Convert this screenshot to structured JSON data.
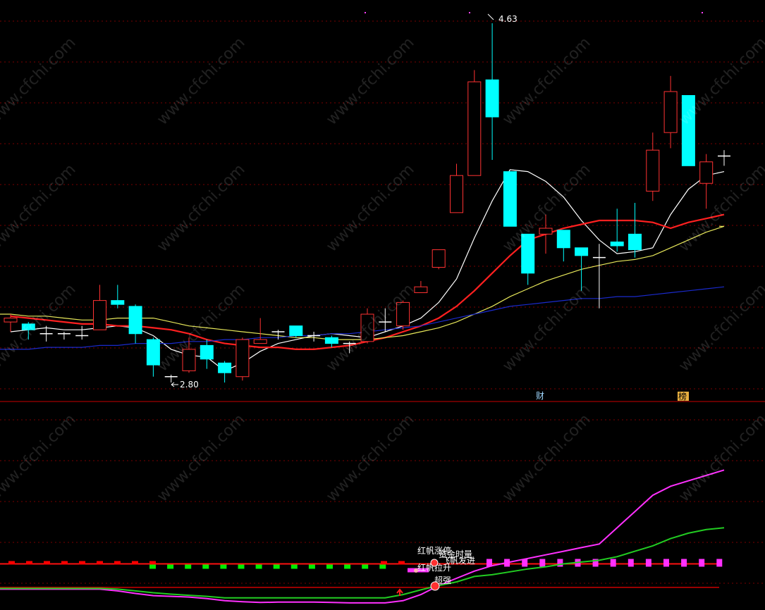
{
  "chart_data": [
    {
      "type": "candlestick",
      "labels": {
        "max_label": "4.63",
        "min_label": "2.80",
        "cai_mark": "财",
        "bang_mark": "榜"
      },
      "candles": [
        {
          "o": 3.1,
          "h": 3.14,
          "l": 3.05,
          "c": 3.12
        },
        {
          "o": 3.09,
          "h": 3.1,
          "l": 3.01,
          "c": 3.06
        },
        {
          "o": 3.04,
          "h": 3.08,
          "l": 3.0,
          "c": 3.03
        },
        {
          "o": 3.03,
          "h": 3.05,
          "l": 3.01,
          "c": 3.04
        },
        {
          "o": 3.03,
          "h": 3.08,
          "l": 3.01,
          "c": 3.03
        },
        {
          "o": 3.06,
          "h": 3.29,
          "l": 3.06,
          "c": 3.21
        },
        {
          "o": 3.21,
          "h": 3.29,
          "l": 3.17,
          "c": 3.19
        },
        {
          "o": 3.18,
          "h": 3.19,
          "l": 2.99,
          "c": 3.04
        },
        {
          "o": 3.01,
          "h": 3.02,
          "l": 2.82,
          "c": 2.88
        },
        {
          "o": 2.82,
          "h": 2.83,
          "l": 2.79,
          "c": 2.82
        },
        {
          "o": 2.85,
          "h": 3.02,
          "l": 2.84,
          "c": 2.96
        },
        {
          "o": 2.98,
          "h": 3.01,
          "l": 2.86,
          "c": 2.91
        },
        {
          "o": 2.89,
          "h": 2.9,
          "l": 2.79,
          "c": 2.84
        },
        {
          "o": 2.82,
          "h": 3.02,
          "l": 2.8,
          "c": 3.01
        },
        {
          "o": 2.99,
          "h": 3.12,
          "l": 2.99,
          "c": 3.01
        },
        {
          "o": 3.05,
          "h": 3.06,
          "l": 3.01,
          "c": 3.05
        },
        {
          "o": 3.08,
          "h": 3.08,
          "l": 3.02,
          "c": 3.03
        },
        {
          "o": 3.03,
          "h": 3.05,
          "l": 3.0,
          "c": 3.02
        },
        {
          "o": 3.02,
          "h": 3.03,
          "l": 2.97,
          "c": 2.99
        },
        {
          "o": 2.99,
          "h": 3.0,
          "l": 2.94,
          "c": 2.99
        },
        {
          "o": 3.0,
          "h": 3.17,
          "l": 2.99,
          "c": 3.14
        },
        {
          "o": 3.1,
          "h": 3.17,
          "l": 3.05,
          "c": 3.09
        },
        {
          "o": 3.08,
          "h": 3.21,
          "l": 3.06,
          "c": 3.2
        },
        {
          "o": 3.25,
          "h": 3.31,
          "l": 3.25,
          "c": 3.28
        },
        {
          "o": 3.38,
          "h": 3.47,
          "l": 3.37,
          "c": 3.47
        },
        {
          "o": 3.66,
          "h": 3.91,
          "l": 3.66,
          "c": 3.85
        },
        {
          "o": 3.85,
          "h": 4.39,
          "l": 3.85,
          "c": 4.33
        },
        {
          "o": 4.34,
          "h": 4.63,
          "l": 3.93,
          "c": 4.15
        },
        {
          "o": 3.87,
          "h": 3.87,
          "l": 3.59,
          "c": 3.59
        },
        {
          "o": 3.55,
          "h": 3.55,
          "l": 3.29,
          "c": 3.35
        },
        {
          "o": 3.55,
          "h": 3.65,
          "l": 3.45,
          "c": 3.58
        },
        {
          "o": 3.57,
          "h": 3.57,
          "l": 3.41,
          "c": 3.48
        },
        {
          "o": 3.48,
          "h": 3.48,
          "l": 3.26,
          "c": 3.44
        },
        {
          "o": 3.42,
          "h": 3.5,
          "l": 3.17,
          "c": 3.43
        },
        {
          "o": 3.51,
          "h": 3.68,
          "l": 3.46,
          "c": 3.49
        },
        {
          "o": 3.55,
          "h": 3.71,
          "l": 3.43,
          "c": 3.47
        },
        {
          "o": 3.77,
          "h": 4.07,
          "l": 3.72,
          "c": 3.98
        },
        {
          "o": 4.07,
          "h": 4.36,
          "l": 3.99,
          "c": 4.28
        },
        {
          "o": 4.26,
          "h": 4.26,
          "l": 3.9,
          "c": 3.9
        },
        {
          "o": 3.81,
          "h": 3.96,
          "l": 3.68,
          "c": 3.92
        },
        {
          "o": 3.94,
          "h": 3.98,
          "l": 3.9,
          "c": 3.95
        }
      ],
      "ma_colors": [
        "#ffffff",
        "#ff2020",
        "#e8e85a",
        "#1a2acc"
      ],
      "ma_lines": [
        [
          3.05,
          3.06,
          3.07,
          3.06,
          3.06,
          3.07,
          3.08,
          3.07,
          3.03,
          2.96,
          2.93,
          2.92,
          2.85,
          2.89,
          2.95,
          2.99,
          3.01,
          3.03,
          3.04,
          3.03,
          3.02,
          3.05,
          3.08,
          3.12,
          3.2,
          3.32,
          3.53,
          3.72,
          3.88,
          3.87,
          3.82,
          3.74,
          3.62,
          3.52,
          3.45,
          3.46,
          3.48,
          3.65,
          3.78,
          3.85,
          3.87
        ],
        [
          3.13,
          3.12,
          3.11,
          3.1,
          3.09,
          3.09,
          3.08,
          3.08,
          3.07,
          3.06,
          3.04,
          3.01,
          2.99,
          2.98,
          2.97,
          2.97,
          2.96,
          2.96,
          2.97,
          2.98,
          3.0,
          3.02,
          3.05,
          3.08,
          3.12,
          3.18,
          3.26,
          3.35,
          3.44,
          3.52,
          3.55,
          3.58,
          3.6,
          3.62,
          3.62,
          3.62,
          3.61,
          3.58,
          3.61,
          3.63,
          3.65
        ],
        [
          3.14,
          3.13,
          3.13,
          3.12,
          3.11,
          3.11,
          3.12,
          3.12,
          3.12,
          3.1,
          3.08,
          3.07,
          3.06,
          3.05,
          3.04,
          3.03,
          3.02,
          3.02,
          3.01,
          3.01,
          3.01,
          3.02,
          3.03,
          3.05,
          3.07,
          3.1,
          3.14,
          3.18,
          3.23,
          3.27,
          3.31,
          3.34,
          3.37,
          3.39,
          3.41,
          3.42,
          3.44,
          3.48,
          3.52,
          3.56,
          3.59
        ],
        [
          2.96,
          2.96,
          2.97,
          2.97,
          2.97,
          2.98,
          2.98,
          2.99,
          2.99,
          2.99,
          3.0,
          3.0,
          3.01,
          3.01,
          3.02,
          3.02,
          3.03,
          3.03,
          3.04,
          3.04,
          3.05,
          3.06,
          3.07,
          3.08,
          3.1,
          3.12,
          3.14,
          3.16,
          3.18,
          3.19,
          3.2,
          3.21,
          3.22,
          3.22,
          3.23,
          3.23,
          3.24,
          3.25,
          3.26,
          3.27,
          3.28
        ]
      ],
      "y_range": [
        2.7,
        4.72
      ]
    },
    {
      "type": "line",
      "annotations": [
        "红帆涨停",
        "资金时量",
        "飞帆发进",
        "红帆拉升",
        "超强"
      ],
      "series": [
        {
          "color": "#ff30ff",
          "values": [
            5.0,
            5.0,
            5.0,
            5.0,
            5.0,
            5.0,
            4.5,
            3.8,
            3.2,
            3.0,
            2.8,
            2.4,
            1.8,
            1.5,
            1.3,
            1.4,
            1.4,
            1.4,
            1.3,
            1.2,
            1.2,
            1.2,
            1.8,
            3.5,
            6.0,
            8.0,
            10.0,
            11.5,
            12.5,
            13.5,
            14.5,
            15.5,
            16.5,
            17.5,
            22.0,
            26.5,
            31.0,
            33.5,
            35.0,
            36.5,
            38.0
          ]
        },
        {
          "color": "#22cc22",
          "values": [
            5.2,
            5.2,
            5.2,
            5.2,
            5.2,
            5.2,
            5.0,
            4.5,
            4.0,
            3.6,
            3.3,
            3.0,
            2.6,
            2.6,
            2.6,
            2.6,
            2.6,
            2.6,
            2.6,
            2.6,
            2.6,
            2.6,
            3.5,
            4.8,
            6.0,
            7.0,
            8.5,
            9.0,
            9.8,
            10.6,
            11.2,
            12.0,
            12.5,
            13.0,
            14.0,
            15.5,
            17.0,
            19.0,
            20.5,
            21.5,
            22.0
          ]
        }
      ],
      "bars": [
        {
          "color": "#ff0000",
          "count": 23
        },
        {
          "color": "#00ee00",
          "count": 14
        },
        {
          "color": "#ff30ff",
          "count": 14
        }
      ],
      "red_lines": [
        12.0,
        5.5
      ],
      "y_range": [
        0,
        56
      ]
    }
  ],
  "watermark": "www.cfchi.com"
}
